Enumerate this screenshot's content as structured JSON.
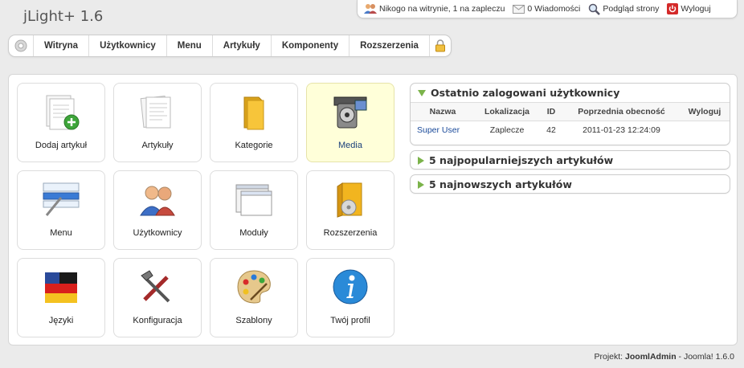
{
  "app_title": "jLight+ 1.6",
  "status": {
    "users_online": "Nikogo na witrynie, 1 na zapleczu",
    "messages": "0 Wiadomości",
    "preview": "Podgląd strony",
    "logout": "Wyloguj"
  },
  "menu": {
    "items": [
      "Witryna",
      "Użytkownicy",
      "Menu",
      "Artykuły",
      "Komponenty",
      "Rozszerzenia"
    ]
  },
  "tiles": [
    {
      "label": "Dodaj artykuł",
      "icon": "add-article-icon"
    },
    {
      "label": "Artykuły",
      "icon": "articles-icon"
    },
    {
      "label": "Kategorie",
      "icon": "folder-icon"
    },
    {
      "label": "Media",
      "icon": "media-icon"
    },
    {
      "label": "Menu",
      "icon": "menu-icon"
    },
    {
      "label": "Użytkownicy",
      "icon": "users-icon"
    },
    {
      "label": "Moduły",
      "icon": "modules-icon"
    },
    {
      "label": "Rozszerzenia",
      "icon": "extensions-icon"
    },
    {
      "label": "Języki",
      "icon": "language-flag-icon"
    },
    {
      "label": "Konfiguracja",
      "icon": "tools-icon"
    },
    {
      "label": "Szablony",
      "icon": "palette-icon"
    },
    {
      "label": "Twój profil",
      "icon": "info-icon"
    }
  ],
  "modules": {
    "logged_users": {
      "title": "Ostatnio zalogowani użytkownicy",
      "columns": [
        "Nazwa",
        "Lokalizacja",
        "ID",
        "Poprzednia obecność",
        "Wyloguj"
      ],
      "rows": [
        {
          "name": "Super User",
          "location": "Zaplecze",
          "id": "42",
          "last_visit": "2011-01-23 12:24:09"
        }
      ]
    },
    "popular": {
      "title": "5 najpopularniejszych artykułów"
    },
    "latest": {
      "title": "5 najnowszych artykułów"
    }
  },
  "footer": {
    "prefix": "Projekt:",
    "brand": "JoomlAdmin",
    "suffix": "- Joomla! 1.6.0"
  },
  "colors": {
    "active_tile_bg": "#ffffd9",
    "link": "#1a4a9a",
    "triangle": "#7bb34a"
  }
}
